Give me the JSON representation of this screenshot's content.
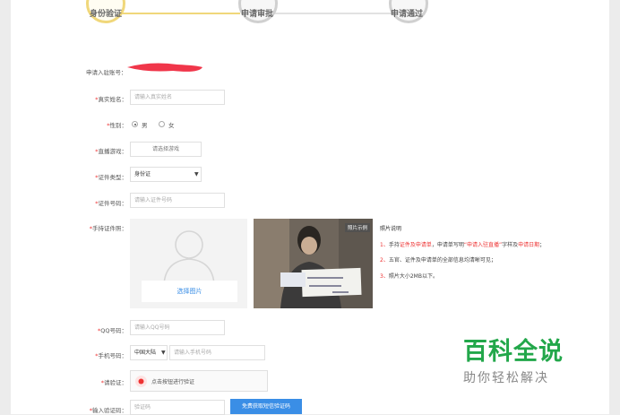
{
  "steps": [
    {
      "label": "身份验证",
      "active": true
    },
    {
      "label": "申请审批",
      "active": false
    },
    {
      "label": "申请通过",
      "active": false
    }
  ],
  "form": {
    "account_label": "申请入驻账号：",
    "real_name": {
      "label": "真实姓名：",
      "placeholder": "请输入真实姓名"
    },
    "gender": {
      "label": "性别：",
      "options": [
        "男",
        "女"
      ],
      "selected": "男"
    },
    "game": {
      "label": "直播游戏：",
      "button": "请选择游戏"
    },
    "id_type": {
      "label": "证件类型：",
      "value": "身份证"
    },
    "id_number": {
      "label": "证件号码：",
      "placeholder": "请输入证件号码"
    },
    "id_photo": {
      "label": "手持证件照：",
      "select_button": "选择图片",
      "sample_badge": "照片示例"
    },
    "qq": {
      "label": "QQ号码：",
      "placeholder": "请输入QQ号码"
    },
    "phone": {
      "label": "手机号码：",
      "region": "中国大陆",
      "placeholder": "请输入手机号码"
    },
    "verify": {
      "label": "请验证：",
      "button": "点击按钮进行验证"
    },
    "code": {
      "label": "输入验证码：",
      "placeholder": "验证码",
      "send_button": "免费获取短信验证码"
    }
  },
  "photo_notes": {
    "title": "照片说明",
    "items": [
      {
        "num": "1、",
        "pre": "手持",
        "red1": "证件及申请单",
        "mid": "，申请单写明",
        "red2": "“申请入驻直播”",
        "mid2": "字样及",
        "red3": "申请日期",
        "post": "；"
      },
      {
        "num": "2、",
        "pre": "五官、证件及申请单的全部信息均清晰可见；"
      },
      {
        "num": "3、",
        "pre": "照片大小2MB以下。"
      }
    ]
  },
  "watermark": {
    "title": "百科全说",
    "subtitle": "助你轻松解决"
  },
  "colors": {
    "accent_yellow": "#f0d77a",
    "required_red": "#e33333",
    "primary_blue": "#3a8ee6",
    "watermark_green": "#22a74a"
  }
}
